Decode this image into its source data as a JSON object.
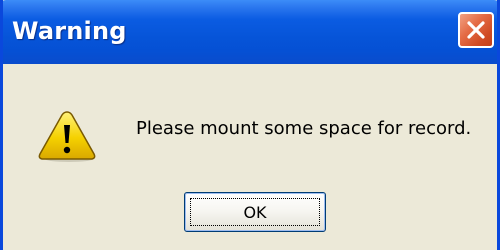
{
  "dialog": {
    "title": "Warning",
    "message": "Please mount some space for record.",
    "icon": "warning-icon",
    "ok_label": "OK"
  },
  "colors": {
    "titlebar": "#0654d8",
    "close_button": "#d04b24",
    "client_background": "#ece9d8",
    "warning_fill": "#f5d100"
  }
}
